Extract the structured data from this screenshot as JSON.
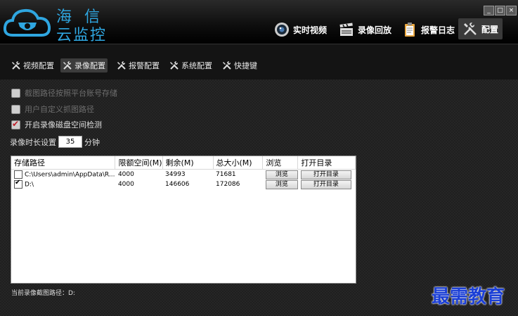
{
  "app": {
    "logo_line1": "海信",
    "logo_line2": "云监控",
    "window_controls": [
      "_",
      "□",
      "×"
    ]
  },
  "nav": {
    "items": [
      {
        "label": "实时视频",
        "icon": "camera-lens-icon"
      },
      {
        "label": "录像回放",
        "icon": "clapperboard-icon"
      },
      {
        "label": "报警日志",
        "icon": "clipboard-icon"
      },
      {
        "label": "配置",
        "icon": "tools-icon",
        "active": true
      }
    ]
  },
  "subtabs": {
    "items": [
      {
        "label": "视频配置"
      },
      {
        "label": "录像配置",
        "active": true
      },
      {
        "label": "报警配置"
      },
      {
        "label": "系统配置"
      },
      {
        "label": "快捷键"
      }
    ]
  },
  "options": {
    "snapshot_by_account": {
      "label": "截图路径按照平台账号存储",
      "checked": false,
      "enabled": false
    },
    "custom_snapshot_path": {
      "label": "用户自定义抓图路径",
      "checked": false,
      "enabled": false
    },
    "disk_space_check": {
      "label": "开启录像磁盘空间检测",
      "checked": true,
      "enabled": true
    }
  },
  "duration": {
    "label": "录像时长设置",
    "value": "35",
    "unit": "分钟"
  },
  "storage_table": {
    "headers": [
      "存储路径",
      "限额空间(M)",
      "剩余(M)",
      "总大小(M)",
      "浏览",
      "打开目录"
    ],
    "rows": [
      {
        "checked": false,
        "path": "C:\\Users\\admin\\AppData\\R...",
        "quota": "4000",
        "free": "34993",
        "total": "71681",
        "browse": "浏览",
        "open": "打开目录"
      },
      {
        "checked": true,
        "path": "D:\\",
        "quota": "4000",
        "free": "146606",
        "total": "172086",
        "browse": "浏览",
        "open": "打开目录"
      }
    ]
  },
  "status": {
    "current_path": "当前录像截图路径：D:"
  },
  "watermark": "最需教育",
  "colors": {
    "accent_blue": "#2fa6e0",
    "check_red": "#c0202a",
    "watermark_blue": "#1b3fd6"
  }
}
